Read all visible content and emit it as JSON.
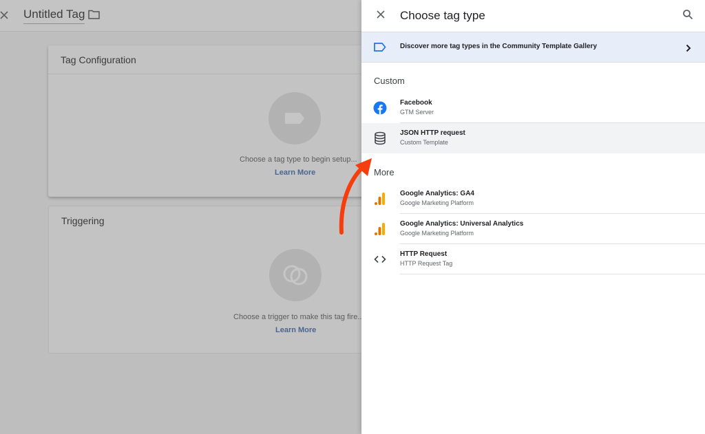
{
  "editor": {
    "title": "Untitled Tag",
    "tag_configuration": {
      "heading": "Tag Configuration",
      "hint": "Choose a tag type to begin setup...",
      "link": "Learn More"
    },
    "triggering": {
      "heading": "Triggering",
      "hint": "Choose a trigger to make this tag fire...",
      "link": "Learn More"
    }
  },
  "panel": {
    "title": "Choose tag type",
    "banner": {
      "label": "Discover more tag types in the Community Template Gallery"
    },
    "sections": [
      {
        "label": "Custom",
        "items": [
          {
            "name": "Facebook",
            "subtitle": "GTM Server",
            "icon": "facebook-icon"
          },
          {
            "name": "JSON HTTP request",
            "subtitle": "Custom Template",
            "icon": "database-icon",
            "highlighted": true
          }
        ]
      },
      {
        "label": "More",
        "items": [
          {
            "name": "Google Analytics: GA4",
            "subtitle": "Google Marketing Platform",
            "icon": "google-analytics-icon"
          },
          {
            "name": "Google Analytics: Universal Analytics",
            "subtitle": "Google Marketing Platform",
            "icon": "google-analytics-icon"
          },
          {
            "name": "HTTP Request",
            "subtitle": "HTTP Request Tag",
            "icon": "code-icon"
          }
        ]
      }
    ]
  },
  "colors": {
    "accent_blue": "#1a73e8",
    "facebook_blue": "#1877f2",
    "analytics_orange": "#f9ab00",
    "analytics_dark_orange": "#e37400",
    "annotation_arrow": "#f53d0d",
    "banner_bg": "#e8eef9"
  }
}
